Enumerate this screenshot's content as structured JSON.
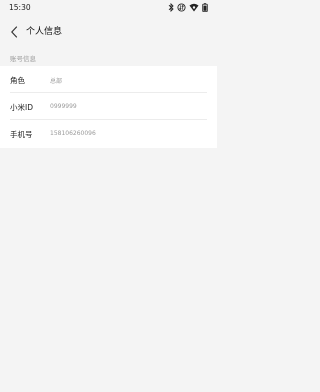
{
  "status_bar": {
    "time": "15:30",
    "icons": [
      "bluetooth-icon",
      "data-transfer-icon",
      "wifi-icon",
      "battery-icon"
    ]
  },
  "nav": {
    "title": "个人信息"
  },
  "section": {
    "header": "账号信息"
  },
  "rows": [
    {
      "label": "角色",
      "value": "总部"
    },
    {
      "label": "小米ID",
      "value": "0999999"
    },
    {
      "label": "手机号",
      "value": "15810626009​6"
    }
  ]
}
